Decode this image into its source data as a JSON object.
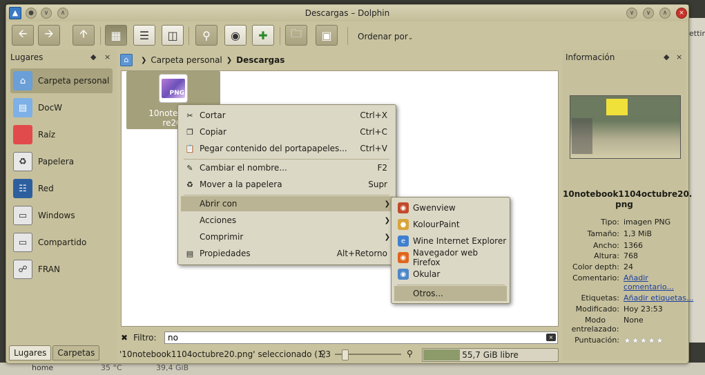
{
  "window": {
    "title": "Descargas – Dolphin"
  },
  "background": {
    "partial_text": "ettin",
    "row_name": "home",
    "row_value": "35 °C",
    "row_size": "39,4 GiB"
  },
  "toolbar": {
    "sort_label": "Ordenar por",
    "buttons": [
      "back-icon",
      "forward-icon",
      "up-icon",
      "icons-view-icon",
      "details-view-icon",
      "columns-view-icon",
      "search-icon",
      "preview-icon",
      "split-icon",
      "new-folder-icon",
      "terminal-icon"
    ]
  },
  "places": {
    "title": "Lugares",
    "items": [
      {
        "label": "Carpeta personal",
        "icon": "home-folder-icon"
      },
      {
        "label": "DocW",
        "icon": "document-folder-icon"
      },
      {
        "label": "Raíz",
        "icon": "root-folder-icon"
      },
      {
        "label": "Papelera",
        "icon": "trash-icon"
      },
      {
        "label": "Red",
        "icon": "network-icon"
      },
      {
        "label": "Windows",
        "icon": "drive-icon"
      },
      {
        "label": "Compartido",
        "icon": "drive-icon"
      },
      {
        "label": "FRAN",
        "icon": "usb-drive-icon"
      }
    ],
    "tabs": [
      "Lugares",
      "Carpetas"
    ]
  },
  "breadcrumb": {
    "parent": "Carpeta personal",
    "current": "Descargas"
  },
  "file": {
    "name_line1": "10notebook",
    "name_line2": "re20.",
    "thumb_text": "PNG"
  },
  "context_menu": {
    "items": [
      {
        "label": "Cortar",
        "shortcut": "Ctrl+X",
        "icon": "scissors-icon"
      },
      {
        "label": "Copiar",
        "shortcut": "Ctrl+C",
        "icon": "copy-icon"
      },
      {
        "label": "Pegar contenido del portapapeles...",
        "shortcut": "Ctrl+V",
        "icon": "paste-icon"
      },
      {
        "label": "Cambiar el nombre...",
        "shortcut": "F2",
        "icon": "rename-icon"
      },
      {
        "label": "Mover a la papelera",
        "shortcut": "Supr",
        "icon": "trash-icon"
      },
      {
        "label": "Abrir con",
        "shortcut": "",
        "icon": ""
      },
      {
        "label": "Acciones",
        "shortcut": "",
        "icon": ""
      },
      {
        "label": "Comprimir",
        "shortcut": "",
        "icon": ""
      },
      {
        "label": "Propiedades",
        "shortcut": "Alt+Retorno",
        "icon": "properties-icon"
      }
    ]
  },
  "open_with_menu": {
    "items": [
      {
        "label": "Gwenview",
        "icon": "gwenview-icon",
        "color": "#c14a2c"
      },
      {
        "label": "KolourPaint",
        "icon": "kolourpaint-icon",
        "color": "#d9a43a"
      },
      {
        "label": "Wine Internet Explorer",
        "icon": "ie-icon",
        "color": "#3f7fcf"
      },
      {
        "label": "Navegador web Firefox",
        "icon": "firefox-icon",
        "color": "#e0661b"
      },
      {
        "label": "Okular",
        "icon": "okular-icon",
        "color": "#4d87c7"
      },
      {
        "label": "Otros...",
        "icon": "",
        "color": ""
      }
    ]
  },
  "filter": {
    "label": "Filtro:",
    "value": "no"
  },
  "status": {
    "message": "'10notebook1104octubre20.png' seleccionado (1,3",
    "free_space": "55,7 GiB libre",
    "used_fraction": 0.27
  },
  "info_panel": {
    "title": "Información",
    "filename_line1": "10notebook1104octubre20.",
    "filename_line2": "png",
    "properties": [
      {
        "key": "Tipo:",
        "value": "imagen PNG"
      },
      {
        "key": "Tamaño:",
        "value": "1,3 MiB"
      },
      {
        "key": "Ancho:",
        "value": "1366"
      },
      {
        "key": "Altura:",
        "value": "768"
      },
      {
        "key": "Color depth:",
        "value": "24"
      },
      {
        "key": "Comentario:",
        "value": "Añadir comentario..."
      },
      {
        "key": "Etiquetas:",
        "value": "Añadir etiquetas..."
      },
      {
        "key": "Modificado:",
        "value": "Hoy 23:53"
      },
      {
        "key": "Modo entrelazado:",
        "value": "None"
      },
      {
        "key": "Puntuación:",
        "value": ""
      }
    ],
    "rating": {
      "stars": 0,
      "max": 5
    }
  }
}
